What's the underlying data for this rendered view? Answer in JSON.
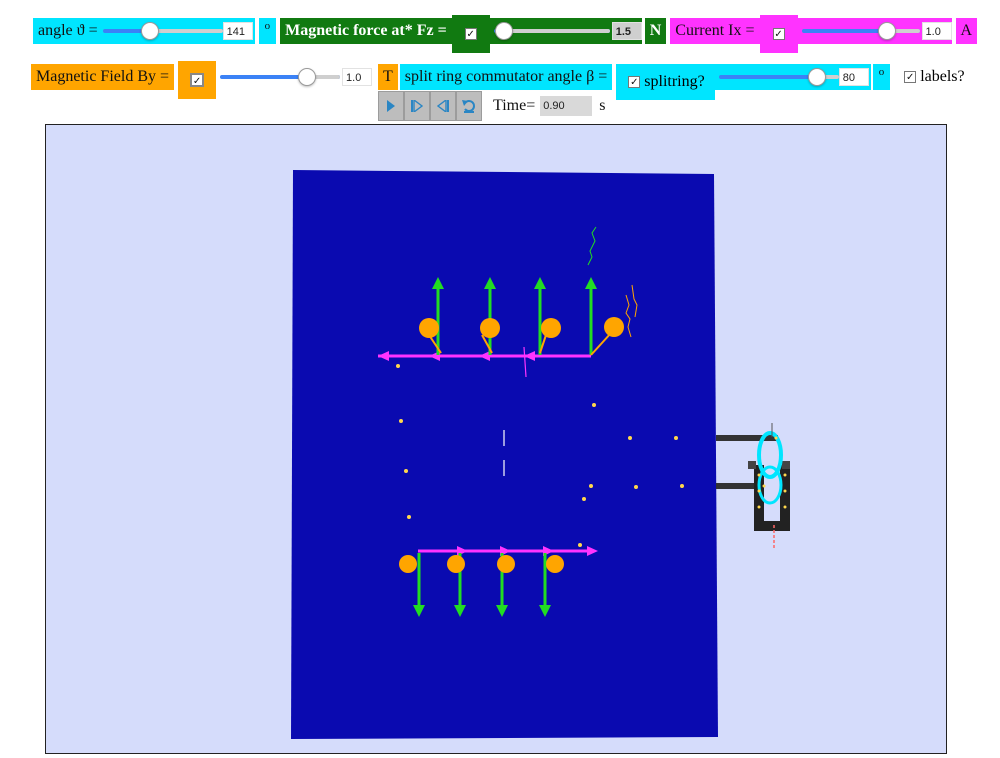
{
  "row1": {
    "angle_label": "angle ϑ =",
    "angle_value": "141",
    "angle_unit": "o",
    "force_label": "Magnetic force at* Fz =",
    "force_value": "1.5",
    "force_unit": "N",
    "current_label": "Current Ix =",
    "current_value": "1.0",
    "current_unit": "A"
  },
  "row2": {
    "field_label": "Magnetic Field By =",
    "field_value": "1.0",
    "field_unit": "T",
    "commutator_label": "split ring commutator angle β =",
    "splitring_label": "splitring?",
    "commutator_value": "80",
    "commutator_unit": "o",
    "labels_label": "labels?"
  },
  "row3": {
    "time_label": "Time=",
    "time_value": "0.90",
    "time_unit": "s"
  },
  "sliders": {
    "angle": 0.39,
    "force": 0.08,
    "current": 0.72,
    "field": 0.72,
    "commutator": 0.81
  },
  "checkbox_mark": "✓",
  "icons": {
    "play": "play-icon",
    "step_forward": "step-forward-icon",
    "step_back": "step-back-icon",
    "reset": "reset-icon"
  },
  "colors": {
    "cyan": "#00e5ff",
    "green": "#117a11",
    "magenta": "#ff33ff",
    "orange": "#ffa500",
    "plate": "#0a0ab0",
    "force_vector": "#22dd22",
    "current_vector": "#ff33ff",
    "sim_background": "#d5dcfb"
  }
}
